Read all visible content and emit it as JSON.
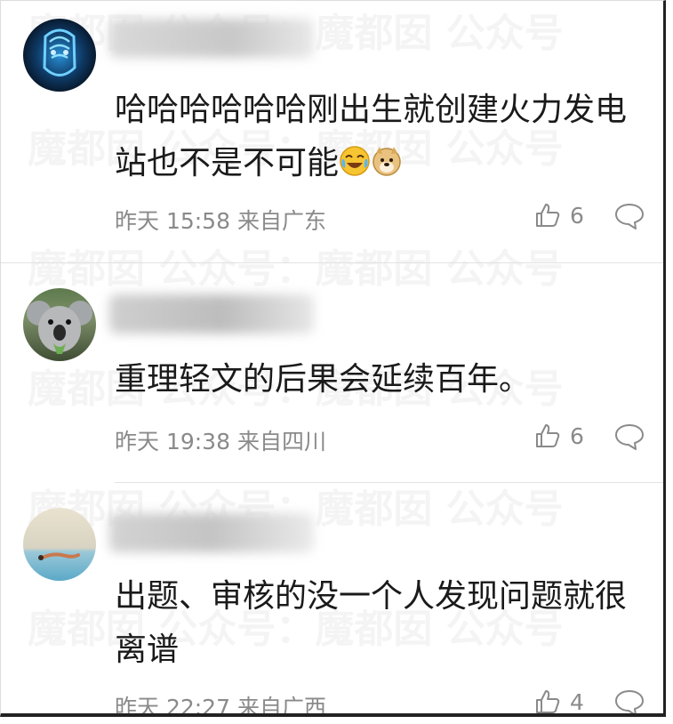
{
  "watermark": "魔都囡 公众号：魔都囡 公众号",
  "comments": [
    {
      "text": "哈哈哈哈哈哈刚出生就创建火力发电站也不是不可能",
      "emojis": [
        "laughing-tears-icon",
        "doge-icon"
      ],
      "time": "昨天 15:58",
      "location": "来自广东",
      "likes": "6"
    },
    {
      "text": "重理轻文的后果会延续百年。",
      "time": "昨天 19:38",
      "location": "来自四川",
      "likes": "6"
    },
    {
      "text": "出题、审核的没一个人发现问题就很离谱",
      "time": "昨天 22:27",
      "location": "来自广西",
      "likes": "4"
    }
  ]
}
